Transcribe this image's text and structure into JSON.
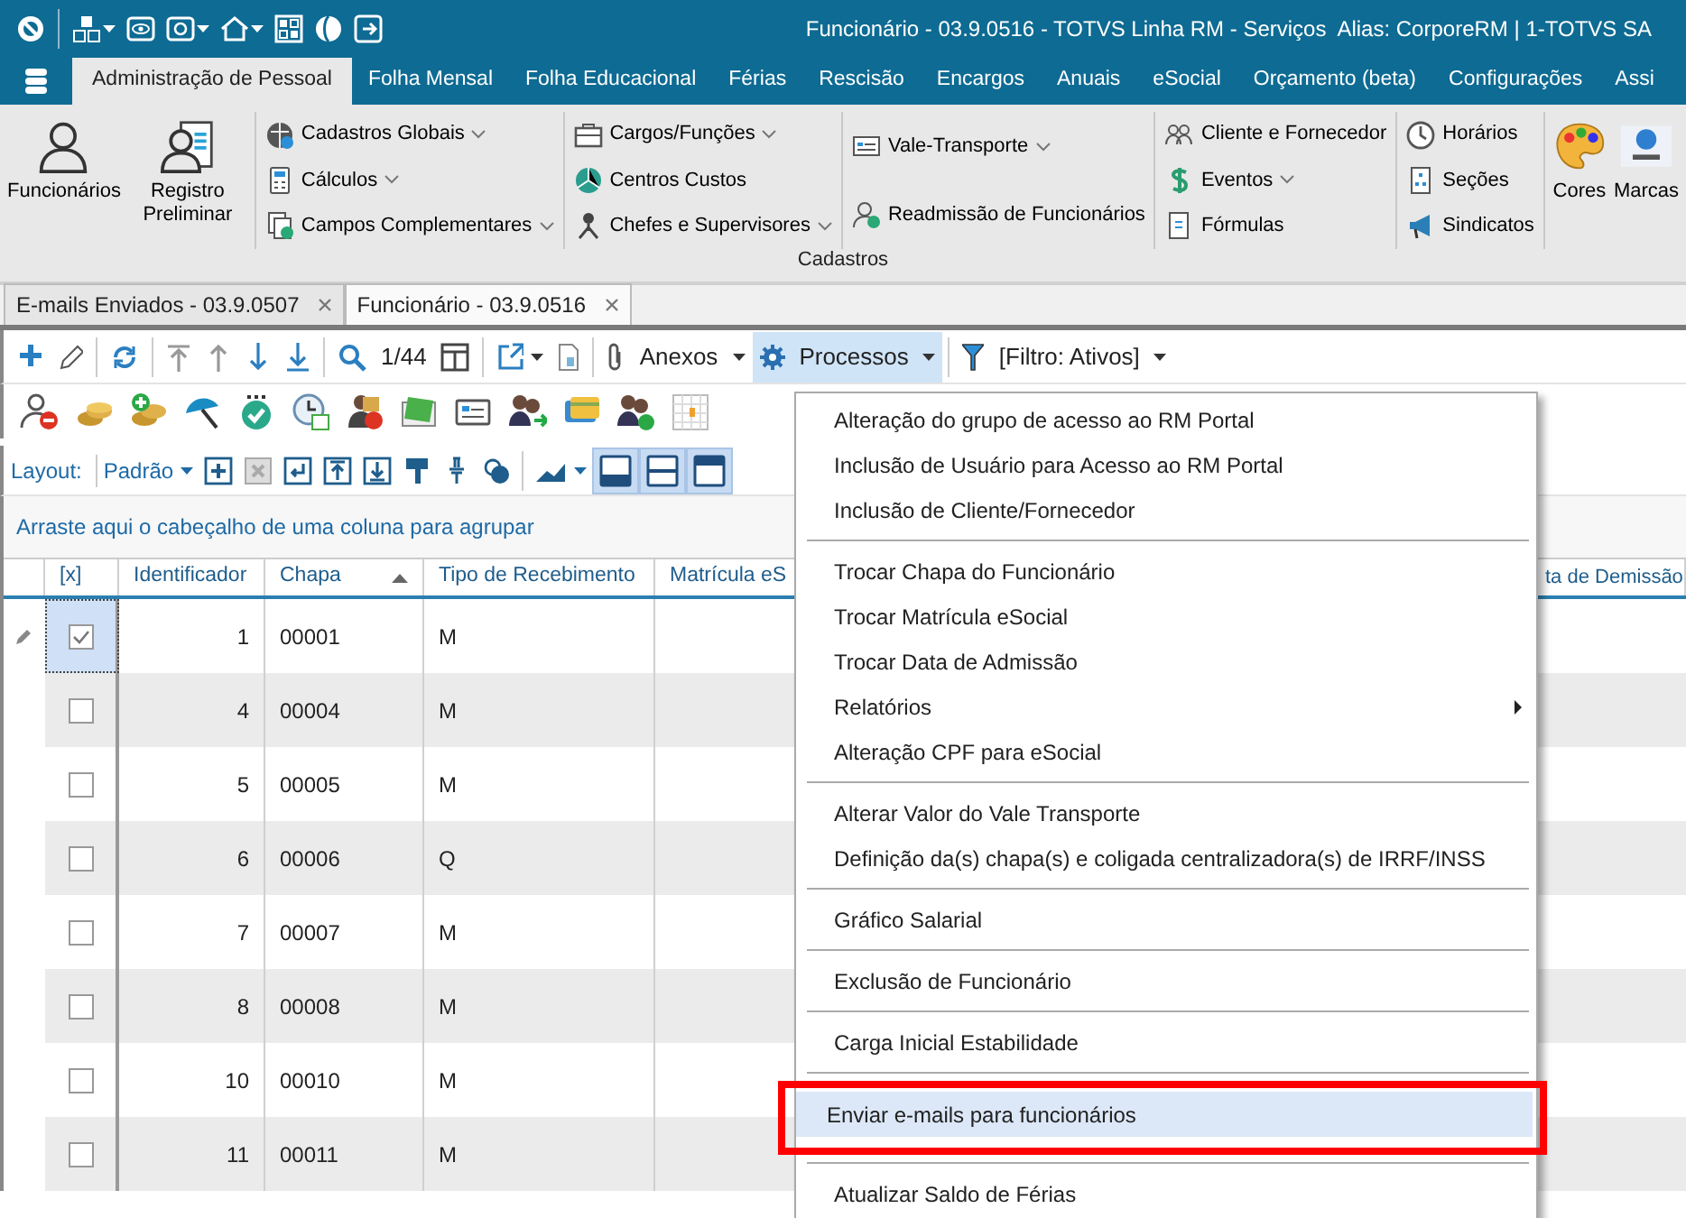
{
  "title_bar": {
    "title": "Funcionário - 03.9.0516 - TOTVS Linha RM - Serviços  Alias: CorporeRM | 1-TOTVS SA"
  },
  "ribbon": {
    "tabs": [
      {
        "label": "Administração de Pessoal",
        "selected": true
      },
      {
        "label": "Folha Mensal",
        "selected": false
      },
      {
        "label": "Folha Educacional",
        "selected": false
      },
      {
        "label": "Férias",
        "selected": false
      },
      {
        "label": "Rescisão",
        "selected": false
      },
      {
        "label": "Encargos",
        "selected": false
      },
      {
        "label": "Anuais",
        "selected": false
      },
      {
        "label": "eSocial",
        "selected": false
      },
      {
        "label": "Orçamento (beta)",
        "selected": false
      },
      {
        "label": "Configurações",
        "selected": false
      },
      {
        "label": "Assi",
        "selected": false
      }
    ],
    "groups": [
      {
        "kind": "large",
        "items": [
          {
            "label": "Funcionários"
          },
          {
            "label": "Registro Preliminar"
          }
        ]
      },
      {
        "kind": "list",
        "items": [
          {
            "label": "Cadastros Globais",
            "dropdown": true
          },
          {
            "label": "Cálculos",
            "dropdown": true
          },
          {
            "label": "Campos Complementares",
            "dropdown": true
          }
        ]
      },
      {
        "kind": "list",
        "items": [
          {
            "label": "Cargos/Funções",
            "dropdown": true
          },
          {
            "label": "Centros Custos",
            "dropdown": false
          },
          {
            "label": "Chefes e Supervisores",
            "dropdown": true
          }
        ]
      },
      {
        "kind": "list",
        "items": [
          {
            "label": "Vale-Transporte",
            "dropdown": true
          },
          {
            "label": "Readmissão de Funcionários",
            "dropdown": false
          }
        ]
      },
      {
        "kind": "list",
        "items": [
          {
            "label": "Cliente e Fornecedor",
            "dropdown": false
          },
          {
            "label": "Eventos",
            "dropdown": true
          },
          {
            "label": "Fórmulas",
            "dropdown": false
          }
        ]
      },
      {
        "kind": "list",
        "items": [
          {
            "label": "Horários",
            "dropdown": false
          },
          {
            "label": "Seções",
            "dropdown": false
          },
          {
            "label": "Sindicatos",
            "dropdown": false
          }
        ]
      },
      {
        "kind": "large",
        "items": [
          {
            "label": "Cores"
          },
          {
            "label": "Marcas"
          }
        ]
      }
    ],
    "group_label": "Cadastros"
  },
  "document_tabs": [
    {
      "label": "E-mails Enviados - 03.9.0507",
      "selected": false
    },
    {
      "label": "Funcionário - 03.9.0516",
      "selected": true
    }
  ],
  "toolbar": {
    "record_counter": "1/44",
    "attachments": "Anexos",
    "processes": {
      "label": "Processos",
      "expanded": true
    },
    "filter": "[Filtro: Ativos]"
  },
  "layout_bar": {
    "label": "Layout:",
    "layout": "Padrão",
    "panel_toggles": [
      {
        "on": true
      },
      {
        "on": true
      },
      {
        "on": true
      }
    ]
  },
  "group_panel": "Arraste aqui o cabeçalho de uma coluna para agrupar",
  "grid": {
    "columns": [
      {
        "label": "[x]"
      },
      {
        "label": "Identificador"
      },
      {
        "label": "Chapa",
        "sorted_ascending": true
      },
      {
        "label": "Tipo de Recebimento"
      },
      {
        "label": "Matrícula eS"
      },
      {
        "label": "ta de Demissão"
      }
    ],
    "rows": [
      {
        "identificador": "1",
        "chapa": "00001",
        "tipo": "M",
        "checked": true,
        "selected": true
      },
      {
        "identificador": "4",
        "chapa": "00004",
        "tipo": "M",
        "checked": false,
        "selected": false
      },
      {
        "identificador": "5",
        "chapa": "00005",
        "tipo": "M",
        "checked": false,
        "selected": false
      },
      {
        "identificador": "6",
        "chapa": "00006",
        "tipo": "Q",
        "checked": false,
        "selected": false
      },
      {
        "identificador": "7",
        "chapa": "00007",
        "tipo": "M",
        "checked": false,
        "selected": false
      },
      {
        "identificador": "8",
        "chapa": "00008",
        "tipo": "M",
        "checked": false,
        "selected": false
      },
      {
        "identificador": "10",
        "chapa": "00010",
        "tipo": "M",
        "checked": false,
        "selected": false
      },
      {
        "identificador": "11",
        "chapa": "00011",
        "tipo": "M",
        "checked": false,
        "selected": false
      }
    ]
  },
  "context_menu": {
    "groups": [
      [
        {
          "label": "Alteração do grupo de acesso ao RM Portal",
          "selected": false
        },
        {
          "label": "Inclusão de Usuário para Acesso ao RM Portal",
          "selected": false
        },
        {
          "label": "Inclusão de Cliente/Fornecedor",
          "selected": false
        }
      ],
      [
        {
          "label": "Trocar Chapa do Funcionário",
          "selected": false
        },
        {
          "label": "Trocar Matrícula eSocial",
          "selected": false
        },
        {
          "label": "Trocar Data de Admissão",
          "selected": false
        },
        {
          "label": "Relatórios",
          "selected": false,
          "submenu": true
        },
        {
          "label": "Alteração CPF para eSocial",
          "selected": false
        }
      ],
      [
        {
          "label": "Alterar Valor do Vale Transporte",
          "selected": false
        },
        {
          "label": "Definição da(s) chapa(s)  e coligada centralizadora(s) de IRRF/INSS",
          "selected": false
        }
      ],
      [
        {
          "label": "Gráfico Salarial",
          "selected": false
        }
      ],
      [
        {
          "label": "Exclusão de Funcionário",
          "selected": false
        }
      ],
      [
        {
          "label": "Carga Inicial Estabilidade",
          "selected": false
        }
      ],
      [
        {
          "label": "Enviar e-mails para funcionários",
          "selected": true,
          "annotated": true
        }
      ],
      [
        {
          "label": "Atualizar Saldo de Férias",
          "selected": false
        }
      ]
    ]
  }
}
